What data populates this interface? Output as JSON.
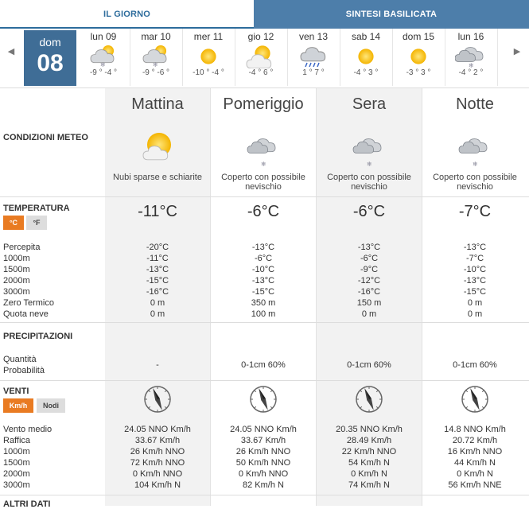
{
  "tabs": [
    {
      "label": "IL GIORNO",
      "active": true
    },
    {
      "label": "SINTESI BASILICATA",
      "active": false
    }
  ],
  "today": {
    "name": "dom",
    "num": "08"
  },
  "days": [
    {
      "label": "lun 09",
      "icon": "cloud-snow-sun-icon",
      "temp": "-9 ° -4 °"
    },
    {
      "label": "mar 10",
      "icon": "cloud-snow-sun-icon",
      "temp": "-9 ° -6 °"
    },
    {
      "label": "mer 11",
      "icon": "sun-icon",
      "temp": "-10 ° -4 °"
    },
    {
      "label": "gio 12",
      "icon": "sun-cloud-icon",
      "temp": "-4 ° 6 °"
    },
    {
      "label": "ven 13",
      "icon": "cloud-rain-icon",
      "temp": "1 ° 7 °"
    },
    {
      "label": "sab 14",
      "icon": "sun-icon",
      "temp": "-4 ° 3 °"
    },
    {
      "label": "dom 15",
      "icon": "sun-icon",
      "temp": "-3 ° 3 °"
    },
    {
      "label": "lun 16",
      "icon": "cloud-snow-icon",
      "temp": "-4 ° 2 °"
    }
  ],
  "periods": [
    "Mattina",
    "Pomeriggio",
    "Sera",
    "Notte"
  ],
  "sections": {
    "conditions": "CONDIZIONI METEO",
    "temperature": "TEMPERATURA",
    "precipitation": "PRECIPITAZIONI",
    "wind": "VENTI",
    "other": "ALTRI DATI"
  },
  "units": {
    "celsius": "°C",
    "fahrenheit": "°F",
    "kmh": "Km/h",
    "knots": "Nodi"
  },
  "conditions": [
    {
      "icon": "sun-cloud-icon",
      "text": "Nubi sparse e schiarite"
    },
    {
      "icon": "cloud-snow-icon",
      "text": "Coperto con possibile nevischio"
    },
    {
      "icon": "cloud-snow-icon",
      "text": "Coperto con possibile nevischio"
    },
    {
      "icon": "cloud-snow-icon",
      "text": "Coperto con possibile nevischio"
    }
  ],
  "temps": [
    "-11°C",
    "-6°C",
    "-6°C",
    "-7°C"
  ],
  "temp_labels": [
    "Percepita",
    "1000m",
    "1500m",
    "2000m",
    "3000m",
    "Zero Termico",
    "Quota neve"
  ],
  "temp_values": [
    [
      "-20°C",
      "-11°C",
      "-13°C",
      "-15°C",
      "-16°C",
      "0 m",
      "0 m"
    ],
    [
      "-13°C",
      "-6°C",
      "-10°C",
      "-13°C",
      "-15°C",
      "350 m",
      "100 m"
    ],
    [
      "-13°C",
      "-6°C",
      "-9°C",
      "-12°C",
      "-16°C",
      "150 m",
      "0 m"
    ],
    [
      "-13°C",
      "-7°C",
      "-10°C",
      "-13°C",
      "-15°C",
      "0 m",
      "0 m"
    ]
  ],
  "precip_labels": [
    "Quantità",
    "Probabilità"
  ],
  "precip_values": [
    "-",
    "0-1cm 60%",
    "0-1cm 60%",
    "0-1cm 60%"
  ],
  "wind_labels": [
    "Vento medio",
    "Raffica",
    "1000m",
    "1500m",
    "2000m",
    "3000m"
  ],
  "wind_dirs_deg": [
    337.5,
    337.5,
    337.5,
    337.5
  ],
  "wind_values": [
    [
      "24.05 NNO Km/h",
      "33.67 Km/h",
      "26 Km/h NNO",
      "72 Km/h NNO",
      "0 Km/h NNO",
      "104 Km/h N"
    ],
    [
      "24.05 NNO Km/h",
      "33.67 Km/h",
      "26 Km/h NNO",
      "50 Km/h NNO",
      "0 Km/h NNO",
      "82 Km/h N"
    ],
    [
      "20.35 NNO Km/h",
      "28.49 Km/h",
      "22 Km/h NNO",
      "54 Km/h N",
      "0 Km/h N",
      "74 Km/h N"
    ],
    [
      "14.8 NNO Km/h",
      "20.72 Km/h",
      "16 Km/h NNO",
      "44 Km/h N",
      "0 Km/h N",
      "56 Km/h NNE"
    ]
  ]
}
